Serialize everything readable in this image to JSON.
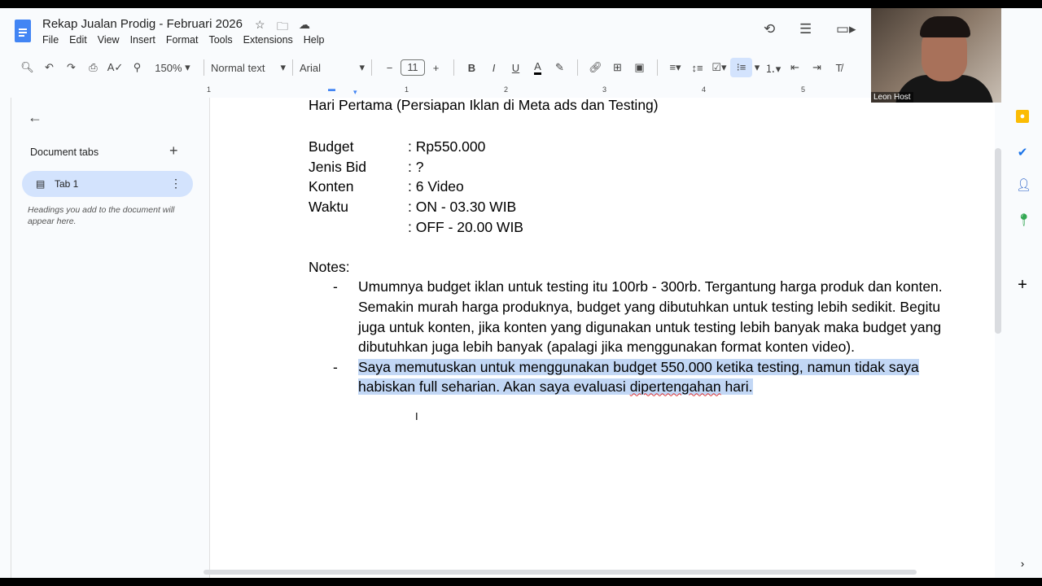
{
  "window": {
    "doc_title": "Rekap Jualan Prodig - Februari 2026"
  },
  "menu": [
    "File",
    "Edit",
    "View",
    "Insert",
    "Format",
    "Tools",
    "Extensions",
    "Help"
  ],
  "toolbar": {
    "zoom": "150%",
    "style": "Normal text",
    "font": "Arial",
    "font_size": "11"
  },
  "ruler": [
    "1",
    "1",
    "2",
    "3",
    "4",
    "5"
  ],
  "sidebar": {
    "section_title": "Document tabs",
    "tabs": [
      {
        "label": "Tab 1"
      }
    ],
    "hint": "Headings you add to the document will appear here."
  },
  "doc": {
    "heading": "Hari Pertama (Persiapan Iklan di Meta ads dan Testing)",
    "fields": [
      {
        "key": "Budget",
        "value": ": Rp550.000"
      },
      {
        "key": "Jenis Bid",
        "value": ": ?"
      },
      {
        "key": "Konten",
        "value": ": 6 Video"
      },
      {
        "key": "Waktu",
        "value": ": ON - 03.30 WIB"
      },
      {
        "key": "",
        "value": ": OFF - 20.00 WIB"
      }
    ],
    "notes_label": "Notes:",
    "notes": [
      {
        "bullet": "-",
        "text": "Umumnya budget iklan untuk testing itu 100rb - 300rb. Tergantung harga produk dan konten. Semakin murah harga produknya, budget yang dibutuhkan untuk testing lebih sedikit. Begitu juga untuk konten, jika konten yang digunakan untuk testing lebih banyak maka budget yang dibutuhkan juga lebih banyak (apalagi jika menggunakan format konten video)."
      },
      {
        "bullet": "-",
        "text_a": "Saya memutuskan untuk menggunakan budget 550.000 ketika testing, namun tidak saya habiskan full seharian. Akan saya evaluasi ",
        "text_misspelled": "dipertengahan",
        "text_b": " hari."
      }
    ]
  },
  "video": {
    "participant": "Leon Host"
  },
  "colors": {
    "accent": "#4285f4",
    "selection": "#c2d7f5",
    "active_tab": "#d3e3fd"
  }
}
